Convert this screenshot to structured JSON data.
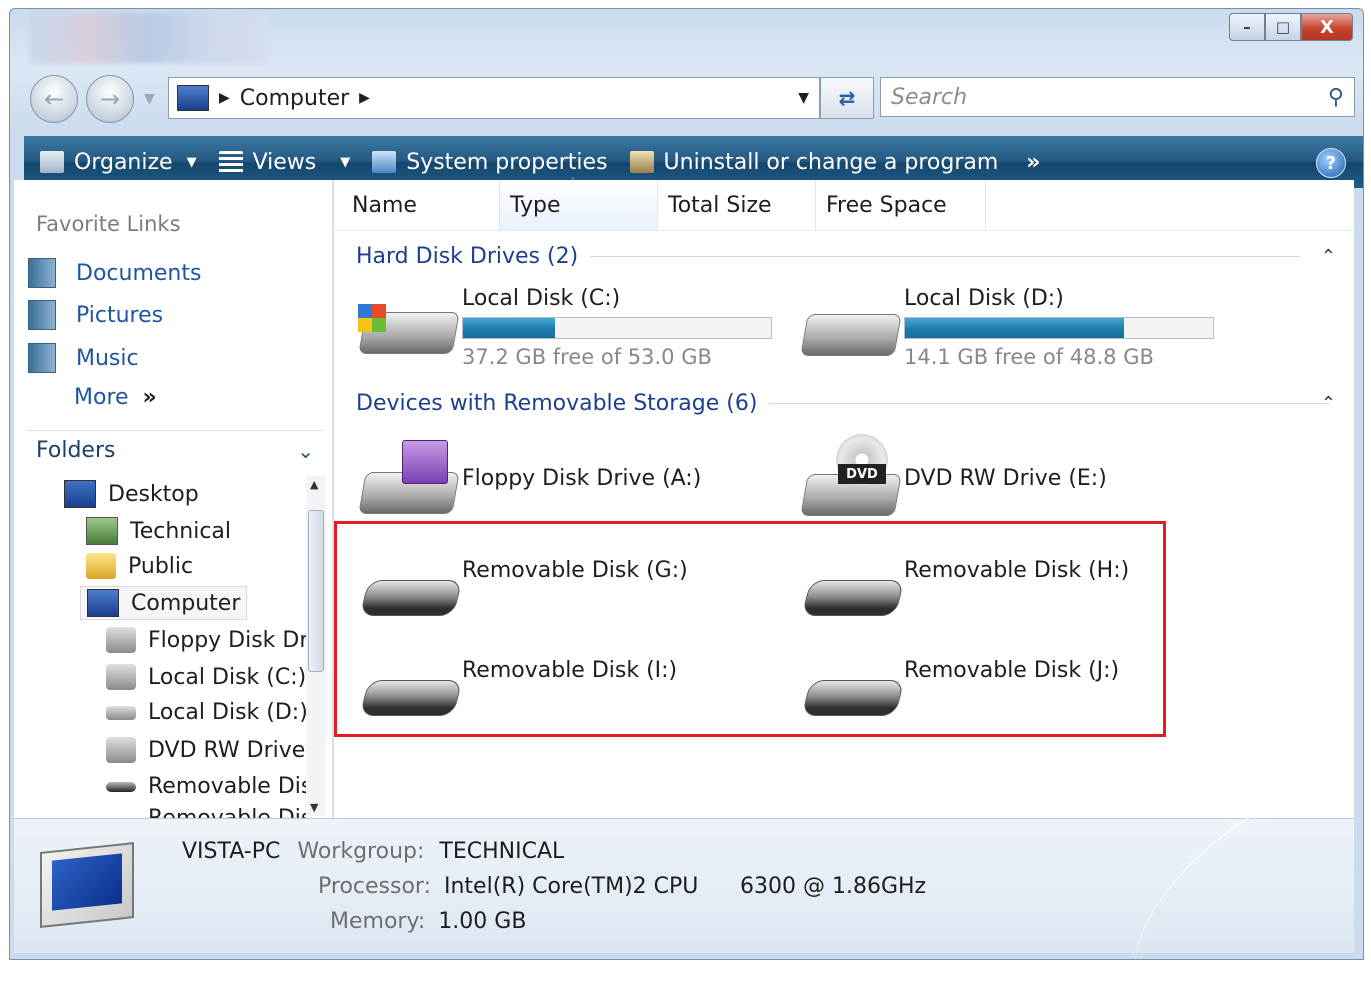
{
  "window": {
    "min": "–",
    "max": "□",
    "close": "X"
  },
  "address": {
    "location": "Computer",
    "search_placeholder": "Search"
  },
  "toolbar": {
    "organize": "Organize",
    "views": "Views",
    "system_properties": "System properties",
    "uninstall": "Uninstall or change a program",
    "more": "»",
    "help": "?"
  },
  "sidebar": {
    "favorite_links_title": "Favorite Links",
    "favorites": [
      "Documents",
      "Pictures",
      "Music"
    ],
    "more": "More",
    "more_chevron": "»",
    "folders_title": "Folders",
    "tree": [
      "Desktop",
      "Technical",
      "Public",
      "Computer",
      "Floppy Disk Dr",
      "Local Disk (C:)",
      "Local Disk (D:)",
      "DVD RW Drive",
      "Removable Dis",
      "Removable Dis"
    ]
  },
  "columns": [
    "Name",
    "Type",
    "Total Size",
    "Free Space"
  ],
  "groups": {
    "hard_disk": "Hard Disk Drives (2)",
    "removable": "Devices with Removable Storage (6)"
  },
  "hard_disks": [
    {
      "name": "Local Disk (C:)",
      "free": "37.2 GB free of 53.0 GB",
      "used_fraction": 0.3
    },
    {
      "name": "Local Disk (D:)",
      "free": "14.1 GB free of 48.8 GB",
      "used_fraction": 0.71
    }
  ],
  "removable_devices": [
    "Floppy Disk Drive (A:)",
    "DVD RW Drive (E:)",
    "Removable Disk (G:)",
    "Removable Disk (H:)",
    "Removable Disk (I:)",
    "Removable Disk (J:)"
  ],
  "dvd_label": "DVD",
  "details": {
    "pc_name": "VISTA-PC",
    "workgroup_label": "Workgroup:",
    "workgroup": "TECHNICAL",
    "processor_label": "Processor:",
    "processor": "Intel(R) Core(TM)2 CPU",
    "processor_speed": "6300  @ 1.86GHz",
    "memory_label": "Memory:",
    "memory": "1.00 GB"
  },
  "colors": {
    "accent": "#1e56a0",
    "toolbar": "#22577f",
    "highlight_box": "#e31b23",
    "bar_fill": "#1f7fae"
  }
}
